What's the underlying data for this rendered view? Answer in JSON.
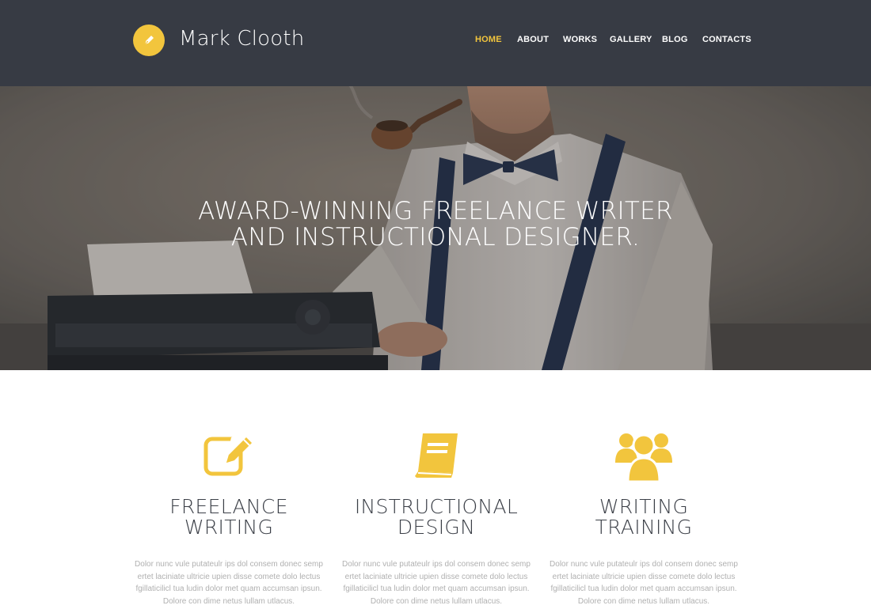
{
  "header": {
    "logo_icon": "pen-nib-icon",
    "logo_text": "Mark Clooth",
    "accent_color": "#f2c53d",
    "background_color": "#373b44"
  },
  "nav": {
    "items": [
      {
        "label": "HOME",
        "active": true
      },
      {
        "label": "ABOUT",
        "active": false
      },
      {
        "label": "WORKS",
        "active": false
      },
      {
        "label": "GALLERY",
        "active": false
      },
      {
        "label": "BLOG",
        "active": false
      },
      {
        "label": "CONTACTS",
        "active": false
      }
    ]
  },
  "hero": {
    "title_line1": "AWARD-WINNING FREELANCE WRITER",
    "title_line2": "AND INSTRUCTIONAL DESIGNER."
  },
  "services": [
    {
      "icon": "edit-icon",
      "title_line1": "FREELANCE",
      "title_line2": "WRITING",
      "text": "Dolor nunc vule putateulr ips dol consem donec semp ertet laciniate ultricie upien disse comete dolo lectus fgillaticilicl tua ludin dolor met quam accumsan ipsun. Dolore con dime netus lullam utlacus."
    },
    {
      "icon": "book-icon",
      "title_line1": "INSTRUCTIONAL",
      "title_line2": "DESIGN",
      "text": "Dolor nunc vule putateulr ips dol consem donec semp ertet laciniate ultricie upien disse comete dolo lectus fgillaticilicl tua ludin dolor met quam accumsan ipsun. Dolore con dime netus lullam utlacus."
    },
    {
      "icon": "users-group-icon",
      "title_line1": "WRITING",
      "title_line2": "TRAINING",
      "text": "Dolor nunc vule putateulr ips dol consem donec semp ertet laciniate ultricie upien disse comete dolo lectus fgillaticilicl tua ludin dolor met quam accumsan ipsun. Dolore con dime netus lullam utlacus."
    }
  ]
}
